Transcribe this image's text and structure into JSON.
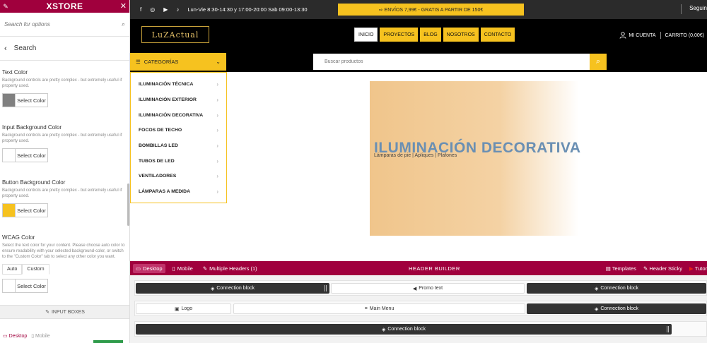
{
  "panel": {
    "brand": "XSTORE",
    "search_placeholder": "Search for options",
    "breadcrumb": "Search",
    "settings": [
      {
        "label": "Text Color",
        "desc": "Background controls are pretty complex - but extremely useful if property used.",
        "button": "Select Color",
        "swatch": "#808080"
      },
      {
        "label": "Input Background Color",
        "desc": "Background controls are pretty complex - but extremely useful if property used.",
        "button": "Select Color",
        "swatch": "#ffffff"
      },
      {
        "label": "Button Background Color",
        "desc": "Background controls are pretty complex - but extremely useful if property used.",
        "button": "Select Color",
        "swatch": "#f6c21f"
      },
      {
        "label": "WCAG Color",
        "desc": "Select the text color for your content. Please choose auto color to ensure readability with your selected background-color, or switch to the \"Custom Color\" tab to select any other color you want.",
        "button": "Select Color",
        "swatch": "#ffffff"
      }
    ],
    "wcag_tabs": [
      "Auto",
      "Custom"
    ],
    "section_button": "INPUT BOXES",
    "footer": {
      "desktop": "Desktop",
      "mobile": "Mobile"
    }
  },
  "site": {
    "topbar": {
      "social": [
        "f",
        "◎",
        "▶",
        "♪"
      ],
      "hours": "Lun-Vie 8:30-14:30 y 17:00-20:00 Sab 09:00-13:30",
      "promo": "⇨ ENVÍOS 7,99€ - GRATIS A PARTIR DE 150€",
      "follow": "Seguin"
    },
    "logo": "LuZActual",
    "nav": [
      "INICIO",
      "PROYECTOS",
      "BLOG",
      "NOSOTROS",
      "CONTACTO"
    ],
    "account": "MI CUENTA",
    "cart": "CARRITO (0,00€)",
    "categories_button": "CATEGORÍAS",
    "search_placeholder": "Buscar productos",
    "categories": [
      "ILUMINACIÓN TÉCNICA",
      "ILUMINACIÓN EXTERIOR",
      "ILUMINACIÓN DECORATIVA",
      "FOCOS DE TECHO",
      "BOMBILLAS LED",
      "TUBOS DE LED",
      "VENTILADORES",
      "LÁMPARAS A MEDIDA"
    ],
    "hero": {
      "title": "ILUMINACIÓN DECORATIVA",
      "subtitle": "Lámparas de pie | Apliques | Plafones"
    }
  },
  "builder": {
    "tabs": {
      "desktop": "Desktop",
      "mobile": "Mobile",
      "multiple": "Multiple Headers (1)"
    },
    "title": "HEADER BUILDER",
    "right": [
      "Templates",
      "Header Sticky",
      "Tutor"
    ],
    "blocks": {
      "connection": "Connection block",
      "promo": "Promo text",
      "logo": "Logo",
      "menu": "Main Menu"
    }
  },
  "colors": {
    "accent": "#a0003d",
    "yellow": "#f6c21f"
  }
}
